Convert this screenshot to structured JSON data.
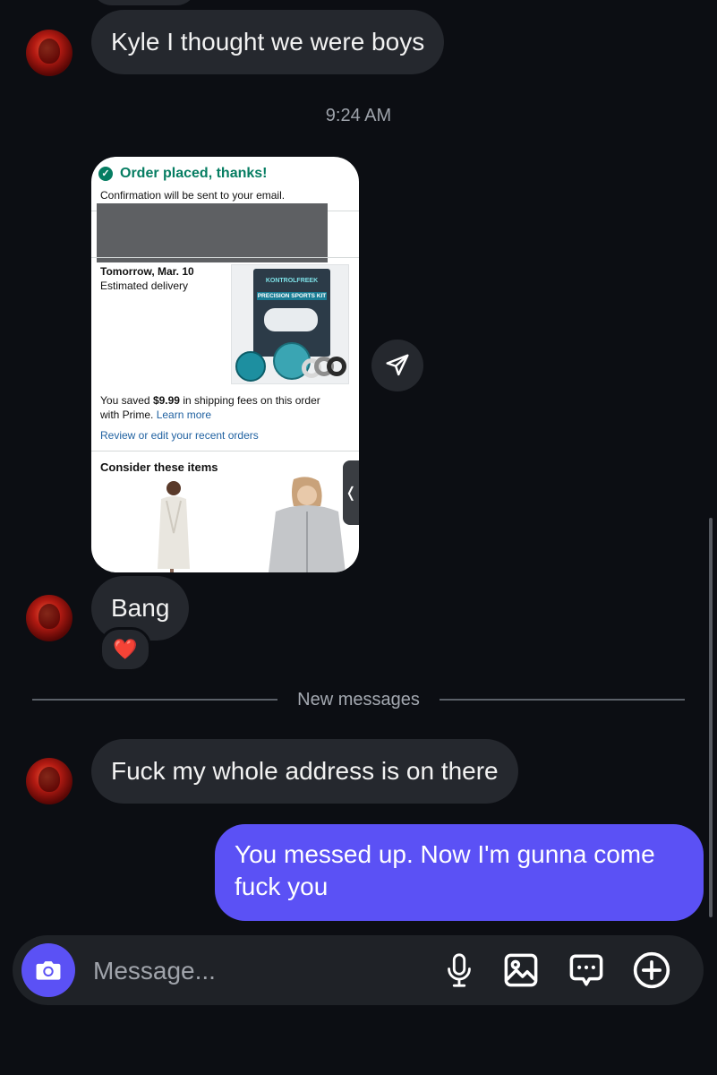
{
  "messages": {
    "m1": "Kyle I thought we were boys",
    "timestamp": "9:24 AM",
    "m2": "Bang",
    "reaction": "❤️",
    "divider": "New messages",
    "m3": "Fuck my whole address is on there",
    "sent": "You messed up. Now I'm gunna come fuck you"
  },
  "receipt": {
    "status": "Order placed, thanks!",
    "confirmation": "Confirmation will be sent to your email.",
    "delivery_date": "Tomorrow, Mar. 10",
    "delivery_label": "Estimated delivery",
    "product_brand": "KONTROLFREEK",
    "product_name": "PRECISION SPORTS KIT",
    "saved_prefix": "You saved ",
    "saved_amount": "$9.99",
    "saved_suffix": " in shipping fees on this order with Prime. ",
    "learn_more": "Learn more",
    "review_link": "Review or edit your recent orders",
    "consider": "Consider these items",
    "side_tab": "❬"
  },
  "composer": {
    "placeholder": "Message..."
  },
  "colors": {
    "background": "#0c0e13",
    "bubble_incoming": "#25282e",
    "bubble_outgoing": "#5b51f5",
    "amazon_green": "#067d62",
    "amazon_link": "#2162a1"
  },
  "icons": [
    "check-circle-icon",
    "share-icon",
    "camera-icon",
    "microphone-icon",
    "image-icon",
    "sticker-icon",
    "plus-circle-icon"
  ]
}
